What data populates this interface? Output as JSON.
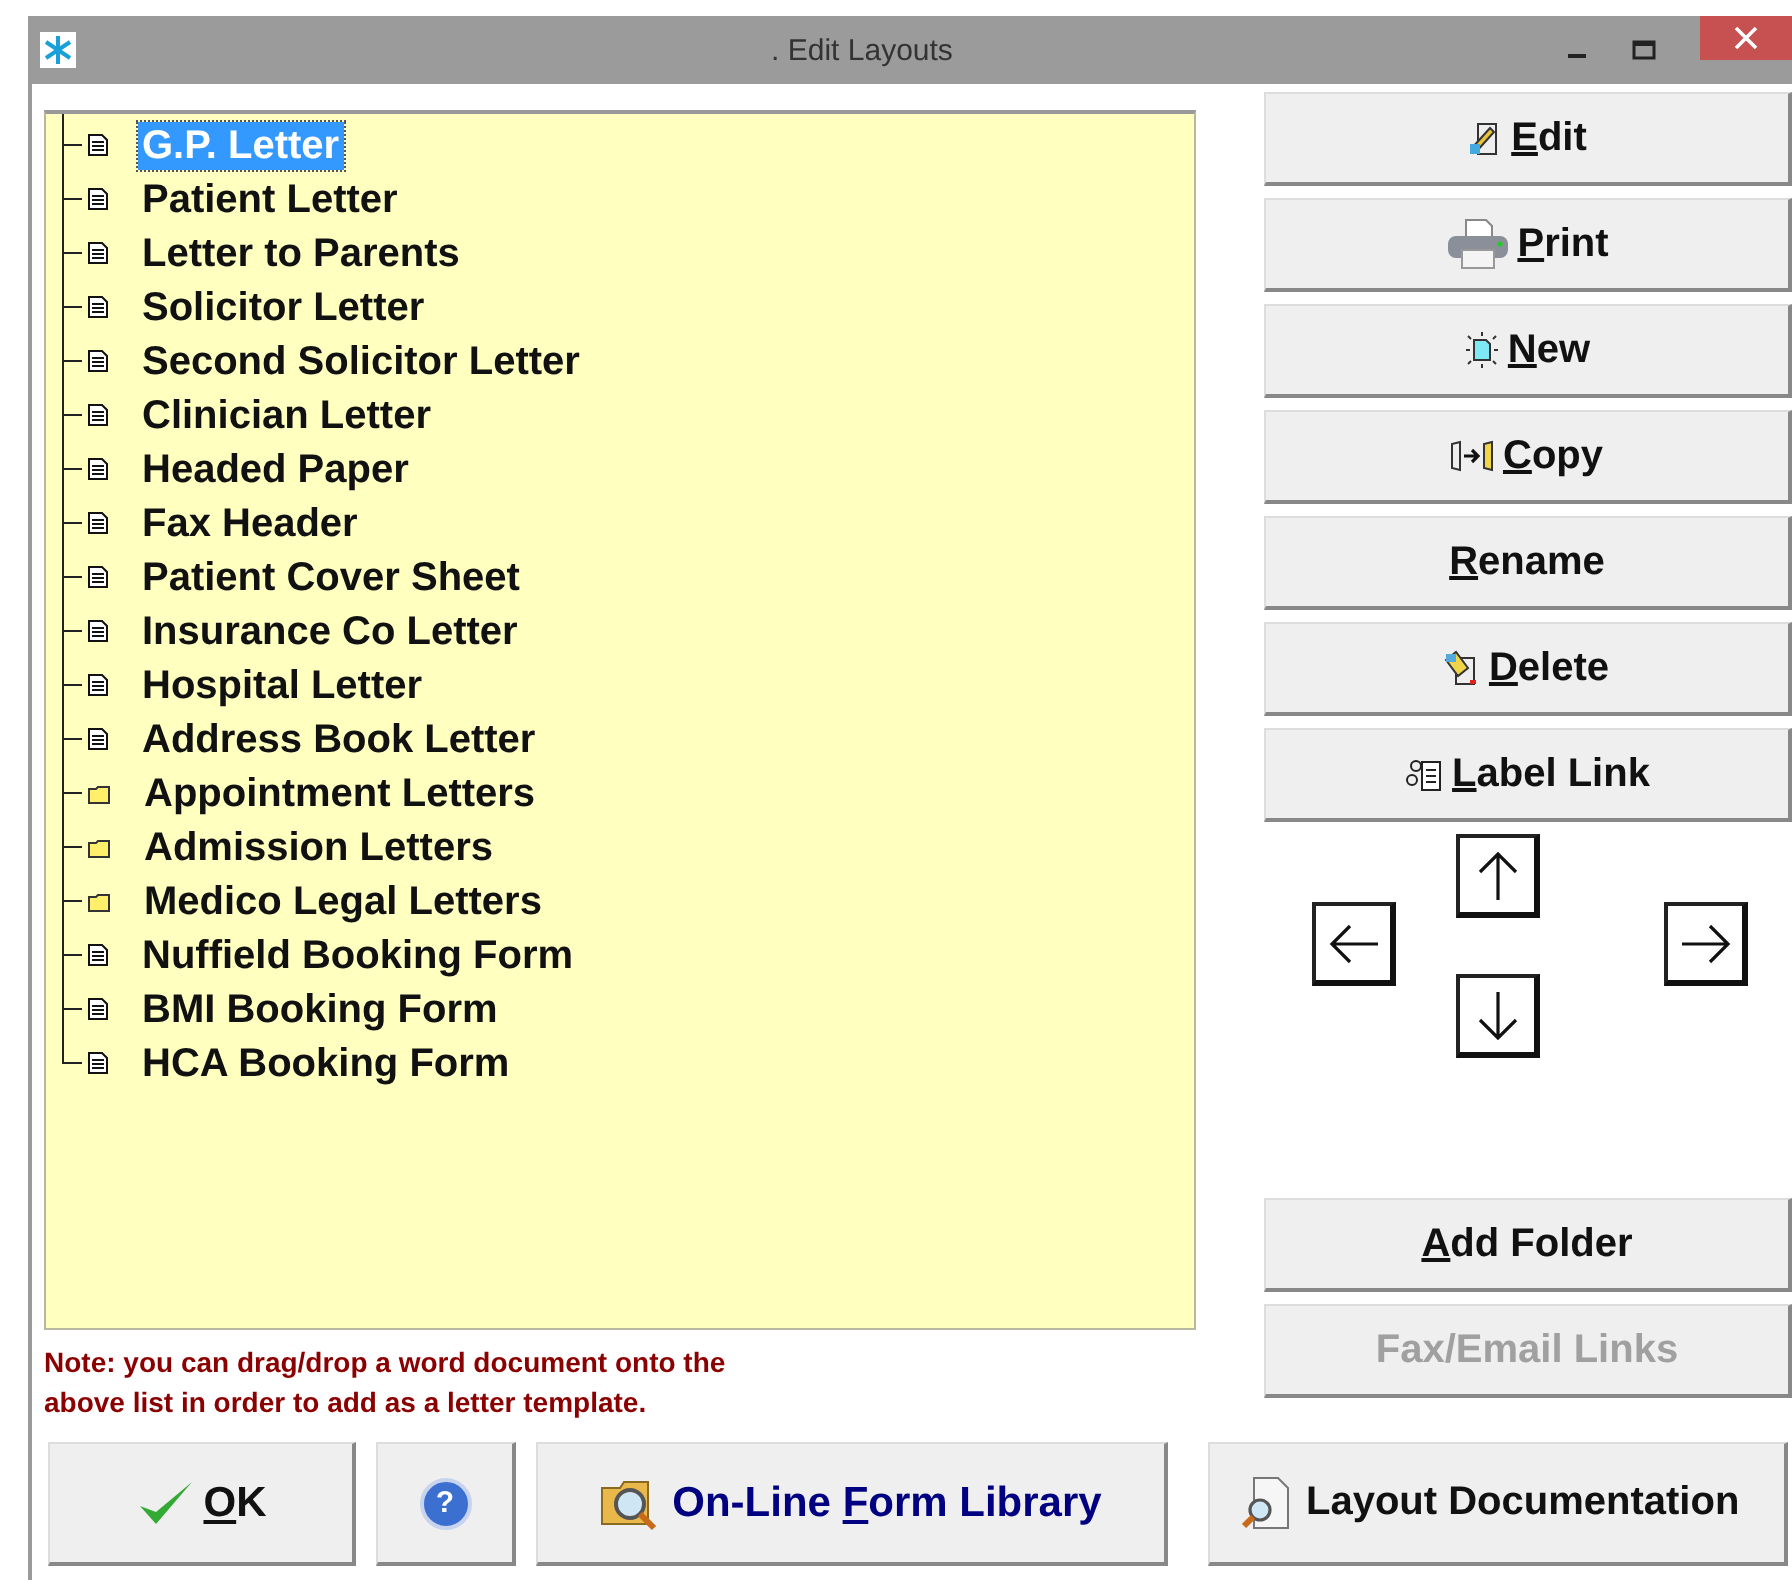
{
  "window": {
    "title": ". Edit Layouts"
  },
  "tree": {
    "items": [
      {
        "label": "G.P. Letter",
        "kind": "document",
        "selected": true
      },
      {
        "label": "Patient Letter",
        "kind": "document",
        "selected": false
      },
      {
        "label": "Letter to Parents",
        "kind": "document",
        "selected": false
      },
      {
        "label": "Solicitor Letter",
        "kind": "document",
        "selected": false
      },
      {
        "label": "Second Solicitor Letter",
        "kind": "document",
        "selected": false
      },
      {
        "label": "Clinician Letter",
        "kind": "document",
        "selected": false
      },
      {
        "label": "Headed Paper",
        "kind": "document",
        "selected": false
      },
      {
        "label": "Fax Header",
        "kind": "document",
        "selected": false
      },
      {
        "label": "Patient Cover Sheet",
        "kind": "document",
        "selected": false
      },
      {
        "label": "Insurance Co Letter",
        "kind": "document",
        "selected": false
      },
      {
        "label": "Hospital Letter",
        "kind": "document",
        "selected": false
      },
      {
        "label": "Address Book Letter",
        "kind": "document",
        "selected": false
      },
      {
        "label": "Appointment Letters",
        "kind": "folder",
        "selected": false
      },
      {
        "label": "Admission Letters",
        "kind": "folder",
        "selected": false
      },
      {
        "label": "Medico Legal Letters",
        "kind": "folder",
        "selected": false
      },
      {
        "label": "Nuffield Booking Form",
        "kind": "document",
        "selected": false
      },
      {
        "label": "BMI Booking Form",
        "kind": "document",
        "selected": false
      },
      {
        "label": "HCA Booking Form",
        "kind": "document",
        "selected": false
      }
    ]
  },
  "note": "Note: you can drag/drop a word document onto the above list in order to add as a letter template.",
  "side_buttons": [
    {
      "kind": "edit",
      "key": "E",
      "rest": "dit"
    },
    {
      "kind": "print",
      "key": "P",
      "rest": "rint"
    },
    {
      "kind": "new",
      "key": "N",
      "rest": "ew"
    },
    {
      "kind": "copy",
      "key": "C",
      "rest": "opy"
    },
    {
      "kind": "rename",
      "key": "R",
      "rest": "ename"
    },
    {
      "kind": "delete",
      "key": "D",
      "rest": "elete"
    },
    {
      "kind": "label-link",
      "key": "L",
      "rest": "abel Link"
    }
  ],
  "folder_buttons": [
    {
      "key": "A",
      "rest": "dd Folder",
      "disabled": false
    },
    {
      "rest": "Fax/Email Links",
      "disabled": true
    }
  ],
  "bottom_buttons": {
    "help": {
      "label": "?"
    },
    "ok": {
      "key": "O",
      "rest": "K"
    },
    "library": {
      "pre": "On-Line ",
      "key": "F",
      "rest": "orm Library"
    },
    "documentation": {
      "label": "Layout Documentation"
    }
  }
}
